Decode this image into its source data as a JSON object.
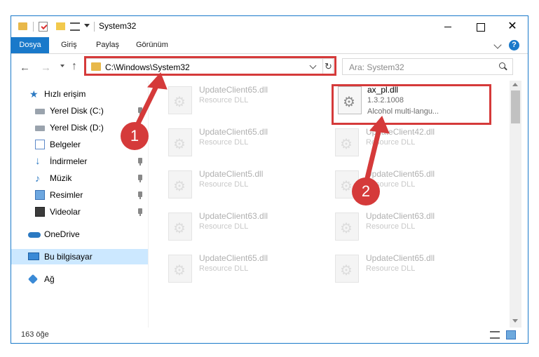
{
  "window": {
    "title": "System32",
    "controls": {
      "minimize": "minimize",
      "maximize": "maximize",
      "close": "✕"
    }
  },
  "ribbon": {
    "tabs": [
      "Dosya",
      "Giriş",
      "Paylaş",
      "Görünüm"
    ],
    "help": "?"
  },
  "navigation": {
    "back": "←",
    "forward": "→",
    "up": "↑",
    "address": "C:\\Windows\\System32",
    "refresh": "↻",
    "search_placeholder": "Ara: System32"
  },
  "sidebar": {
    "items": [
      {
        "label": "Hızlı erişim",
        "icon": "star-icon",
        "pinned": false
      },
      {
        "label": "Yerel Disk (C:)",
        "icon": "disk-icon",
        "pinned": true
      },
      {
        "label": "Yerel Disk (D:)",
        "icon": "disk-icon",
        "pinned": true
      },
      {
        "label": "Belgeler",
        "icon": "document-icon",
        "pinned": true
      },
      {
        "label": "İndirmeler",
        "icon": "download-icon",
        "pinned": true
      },
      {
        "label": "Müzik",
        "icon": "music-icon",
        "pinned": true
      },
      {
        "label": "Resimler",
        "icon": "pictures-icon",
        "pinned": true
      },
      {
        "label": "Videolar",
        "icon": "video-icon",
        "pinned": true
      },
      {
        "label": "OneDrive",
        "icon": "cloud-icon",
        "pinned": false
      },
      {
        "label": "Bu bilgisayar",
        "icon": "computer-icon",
        "pinned": false,
        "selected": true
      },
      {
        "label": "Ağ",
        "icon": "network-icon",
        "pinned": false
      }
    ]
  },
  "files": {
    "target": {
      "name": "ax_pl.dll",
      "version": "1.3.2.1008",
      "description": "Alcohol multi-langu..."
    },
    "tiles": [
      {
        "name": "UpdateClient65.dll",
        "type": "Resource DLL"
      },
      {
        "name": "UpdateClient65.dll",
        "type": "Resource DLL"
      },
      {
        "name": "UpdateClient42.dll",
        "type": "Resource DLL"
      },
      {
        "name": "UpdateClient5.dll",
        "type": "Resource DLL"
      },
      {
        "name": "UpdateClient65.dll",
        "type": "Resource DLL"
      },
      {
        "name": "UpdateClient63.dll",
        "type": "Resource DLL"
      },
      {
        "name": "UpdateClient63.dll",
        "type": "Resource DLL"
      },
      {
        "name": "UpdateClient65.dll",
        "type": "Resource DLL"
      },
      {
        "name": "UpdateClient65.dll",
        "type": "Resource DLL"
      }
    ]
  },
  "status": {
    "count": "163 öğe"
  },
  "annotations": {
    "step1": "1",
    "step2": "2",
    "color": "#d53a3a"
  },
  "colors": {
    "accent": "#1979ca",
    "selection": "#cce8ff",
    "highlight": "#d53a3a"
  }
}
